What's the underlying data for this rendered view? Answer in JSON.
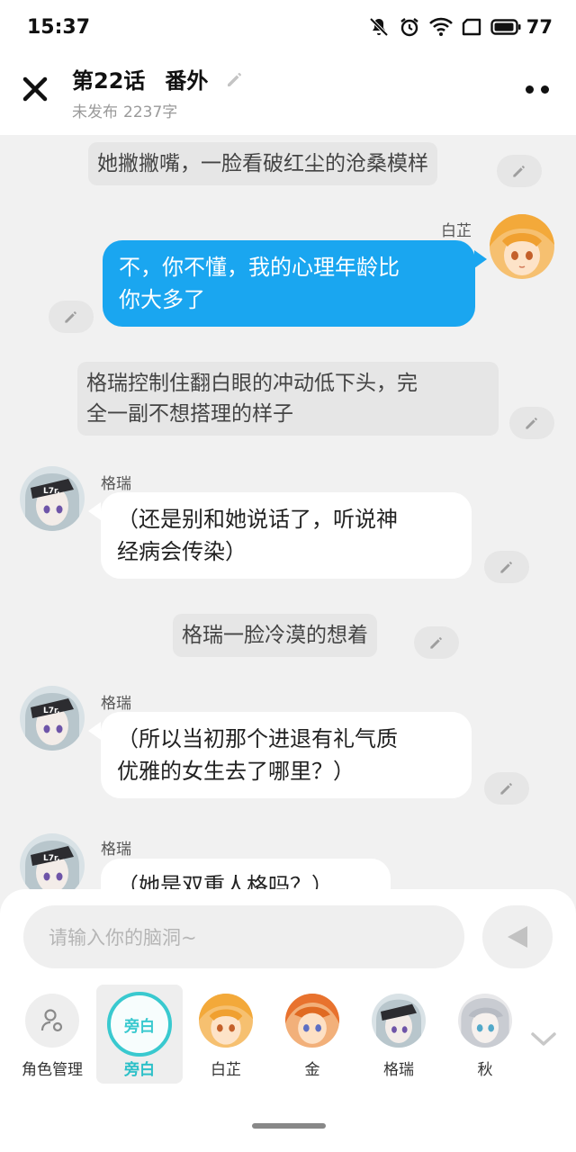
{
  "status_bar": {
    "time": "15:37",
    "battery": "77",
    "icons": [
      "mute-icon",
      "alarm-icon",
      "wifi-icon",
      "sim-icon",
      "battery-icon"
    ]
  },
  "header": {
    "chapter": "第22话",
    "chapter_sub": "番外",
    "status": "未发布",
    "word_count": "2237字"
  },
  "messages": [
    {
      "type": "narration",
      "text": "她撇撇嘴，一脸看破红尘的沧桑模样"
    },
    {
      "type": "bubble",
      "side": "right",
      "speaker": "白芷",
      "lines": [
        "不，你不懂，我的心理年龄比",
        "你大多了"
      ]
    },
    {
      "type": "narration",
      "lines": [
        "格瑞控制住翻白眼的冲动低下头，完",
        "全一副不想搭理的样子"
      ]
    },
    {
      "type": "bubble",
      "side": "left",
      "speaker": "格瑞",
      "lines": [
        "（还是别和她说话了，听说神",
        "经病会传染）"
      ]
    },
    {
      "type": "narration",
      "text": "格瑞一脸冷漠的想着"
    },
    {
      "type": "bubble",
      "side": "left",
      "speaker": "格瑞",
      "lines": [
        "（所以当初那个进退有礼气质",
        "优雅的女生去了哪里？）"
      ]
    },
    {
      "type": "bubble",
      "side": "left",
      "speaker": "格瑞",
      "lines": [
        "（她是双重人格吗？）"
      ]
    }
  ],
  "input": {
    "placeholder": "请输入你的脑洞~"
  },
  "roles": [
    {
      "label": "角色管理",
      "icon": "role-manage-icon"
    },
    {
      "label": "旁白",
      "circle_text": "旁白",
      "active": true
    },
    {
      "label": "白芷"
    },
    {
      "label": "金"
    },
    {
      "label": "格瑞"
    },
    {
      "label": "秋"
    }
  ],
  "colors": {
    "accent_blue": "#1aa6f0",
    "accent_teal": "#39c9cf",
    "background": "#f1f1f1"
  }
}
